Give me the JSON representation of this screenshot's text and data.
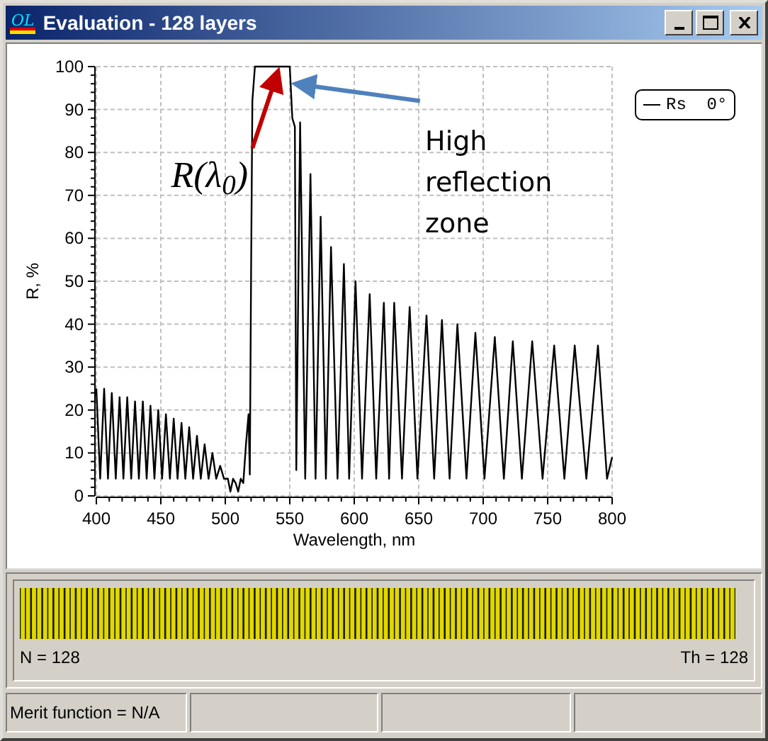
{
  "window": {
    "logo_text": "OL",
    "title": "Evaluation - 128 layers"
  },
  "chart": {
    "chart_data": {
      "type": "line",
      "xlabel": "Wavelength, nm",
      "ylabel": "R, %",
      "xlim": [
        400,
        800
      ],
      "ylim": [
        0,
        100
      ],
      "xticks": [
        400,
        450,
        500,
        550,
        600,
        650,
        700,
        750,
        800
      ],
      "yticks": [
        0,
        10,
        20,
        30,
        40,
        50,
        60,
        70,
        80,
        90,
        100
      ],
      "x": [
        400,
        403,
        406,
        409,
        412,
        415,
        418,
        421,
        424,
        427,
        430,
        433,
        436,
        439,
        442,
        445,
        448,
        451,
        454,
        457,
        460,
        463,
        466,
        469,
        472,
        475,
        478,
        481,
        484,
        487,
        490,
        493,
        496,
        499,
        502,
        504,
        506,
        508,
        510,
        512,
        514,
        516,
        518,
        519,
        520,
        521,
        523,
        550,
        552,
        554,
        555,
        558,
        562,
        566,
        570,
        574,
        578,
        582,
        587,
        592,
        596,
        601,
        606,
        612,
        617,
        623,
        627,
        631,
        637,
        643,
        649,
        656,
        662,
        668,
        674,
        680,
        687,
        694,
        701,
        709,
        716,
        723,
        730,
        738,
        746,
        755,
        763,
        771,
        780,
        789,
        796,
        800
      ],
      "series": [
        {
          "name": "Rs  0°",
          "color": "#000000",
          "values": [
            25,
            4,
            25,
            4,
            24,
            4,
            23,
            4,
            23,
            4,
            22,
            4,
            22,
            4,
            21,
            4,
            20,
            4,
            19,
            4,
            18,
            4,
            17,
            4,
            16,
            4,
            14,
            4,
            12,
            4,
            10,
            4,
            7,
            4,
            4,
            1,
            4,
            3,
            1,
            4,
            3,
            12,
            19,
            5,
            52,
            92,
            100,
            100,
            88,
            86,
            6,
            87,
            4,
            75,
            4,
            65,
            4,
            58,
            4,
            54,
            4,
            50,
            4,
            47,
            4,
            45,
            4,
            45,
            4,
            44,
            4,
            42,
            4,
            41,
            4,
            40,
            4,
            38,
            4,
            37,
            4,
            36,
            4,
            36,
            4,
            35,
            4,
            35,
            4,
            35,
            4,
            9
          ]
        }
      ],
      "grid": true,
      "annotations": [
        "R(λ$_{0}$)",
        "High reflection zone"
      ]
    }
  },
  "layers": {
    "count_label": "N = 128",
    "thickness_label": "Th = 128"
  },
  "status_bar": {
    "merit_text": "Merit function = N/A"
  }
}
